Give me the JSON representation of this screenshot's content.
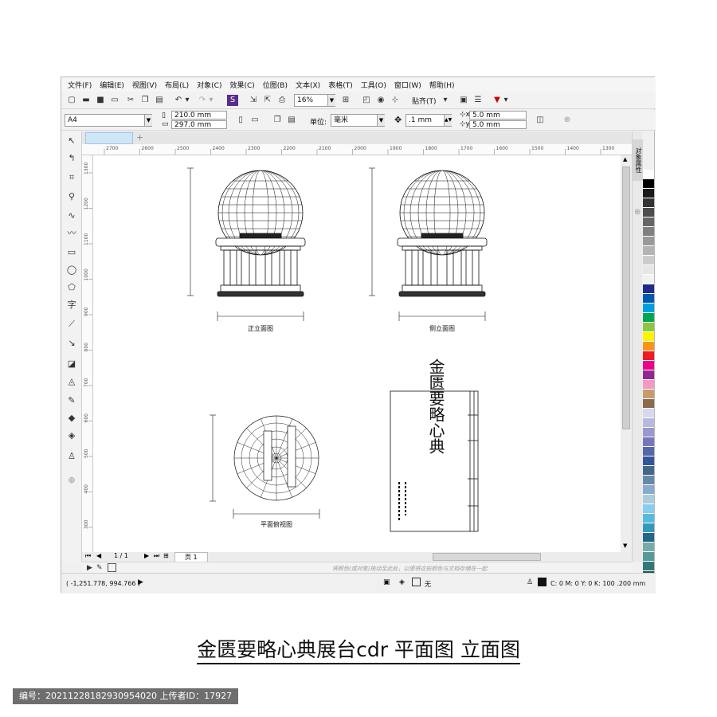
{
  "menu": [
    "文件(F)",
    "编辑(E)",
    "视图(V)",
    "布局(L)",
    "对象(C)",
    "效果(C)",
    "位图(B)",
    "文本(X)",
    "表格(T)",
    "工具(O)",
    "窗口(W)",
    "帮助(H)"
  ],
  "toolbar1": {
    "zoom_value": "16%",
    "snap_label": "贴齐(T)"
  },
  "toolbar2": {
    "page_size": "A4",
    "width": "210.0 mm",
    "height": "297.0 mm",
    "unit_label": "单位:",
    "unit_value": "毫米",
    "nudge": ".1 mm",
    "dup_x": "5.0 mm",
    "dup_y": "5.0 mm"
  },
  "ruler_top_ticks": [
    "2700",
    "2600",
    "2500",
    "2400",
    "2300",
    "2200",
    "2100",
    "2000",
    "1900",
    "1800",
    "1700",
    "1600",
    "1500",
    "1400",
    "1300"
  ],
  "ruler_left_ticks": [
    "1300",
    "1200",
    "1100",
    "1000",
    "900",
    "800",
    "700",
    "600",
    "500",
    "400",
    "300"
  ],
  "views": {
    "front": "正立面图",
    "side": "侧立面图",
    "plan": "平面俯视图",
    "calligraphy_title": "金匮要略心典"
  },
  "pagenav": {
    "page_counter": "1 / 1",
    "page_tab": "页 1"
  },
  "colorbar_hint": "将颜色(或对象)拖动至此处，以便将这些颜色与文档存储在一起",
  "status": {
    "coords": "( -1,251.778, 994.766 )",
    "fill_label": "无",
    "outline_info": "C: 0 M: 0 Y: 0 K: 100  .200 mm"
  },
  "docker": {
    "tab_label": "对象属性"
  },
  "palette_colors": [
    "#ffffff",
    "#000000",
    "#1a1a1a",
    "#333333",
    "#4d4d4d",
    "#666666",
    "#808080",
    "#999999",
    "#b3b3b3",
    "#cccccc",
    "#e6e6e6",
    "#f2f2f2",
    "#1f2a8c",
    "#0058b0",
    "#00a0e0",
    "#00a651",
    "#8dc63f",
    "#fff200",
    "#f7941d",
    "#ed1c24",
    "#ec008c",
    "#92278f",
    "#f49ac2",
    "#c69c6d",
    "#8b6b4a",
    "#d7d7ee",
    "#b8b8e0",
    "#9999cc",
    "#7777bb",
    "#5566aa",
    "#335599",
    "#446688",
    "#6688aa",
    "#88aacc",
    "#aaccdd",
    "#88ccee",
    "#55bbdd",
    "#3399bb",
    "#226688",
    "#77aaaa",
    "#559999",
    "#337777",
    "#225555"
  ],
  "caption": "金匮要略心典展台cdr  平面图  立面图",
  "footer": "编号：20211228182930954020 上传者ID：17927"
}
